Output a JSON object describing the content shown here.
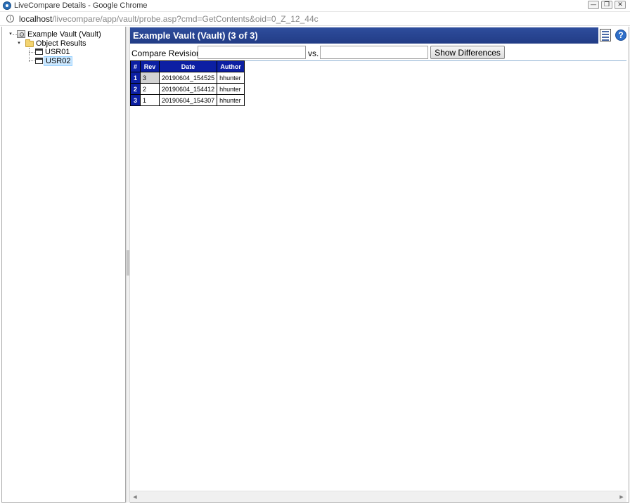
{
  "window": {
    "title": "LiveCompare Details - Google Chrome",
    "minimize_glyph": "—",
    "restore_glyph": "❐",
    "close_glyph": "✕"
  },
  "address": {
    "host": "localhost",
    "path": "/livecompare/app/vault/probe.asp?cmd=GetContents&oid=0_Z_12_44c"
  },
  "tree": {
    "root": {
      "label": "Example Vault (Vault)",
      "icon": "vault-icon"
    },
    "folder": {
      "label": "Object Results",
      "icon": "folder-icon"
    },
    "items": [
      {
        "label": "USR01",
        "icon": "table-icon",
        "selected": false
      },
      {
        "label": "USR02",
        "icon": "table-icon",
        "selected": true
      }
    ]
  },
  "header": {
    "title": "Example Vault (Vault) (3 of 3)",
    "report_icon": "report-icon",
    "help_icon": "help-icon",
    "help_glyph": "?"
  },
  "compare": {
    "label": "Compare Revisions:",
    "vs_label": "vs.",
    "from_value": "",
    "to_value": "",
    "button_label": "Show Differences"
  },
  "table": {
    "columns": [
      "#",
      "Rev",
      "Date",
      "Author"
    ],
    "rows": [
      {
        "idx": "1",
        "rev": "3",
        "date": "20190604_154525",
        "author": "hhunter"
      },
      {
        "idx": "2",
        "rev": "2",
        "date": "20190604_154412",
        "author": "hhunter"
      },
      {
        "idx": "3",
        "rev": "1",
        "date": "20190604_154307",
        "author": "hhunter"
      }
    ]
  },
  "colors": {
    "header_bg": "#223c85",
    "table_header_bg": "#0c1fa3",
    "selection_bg": "#cce8ff"
  }
}
